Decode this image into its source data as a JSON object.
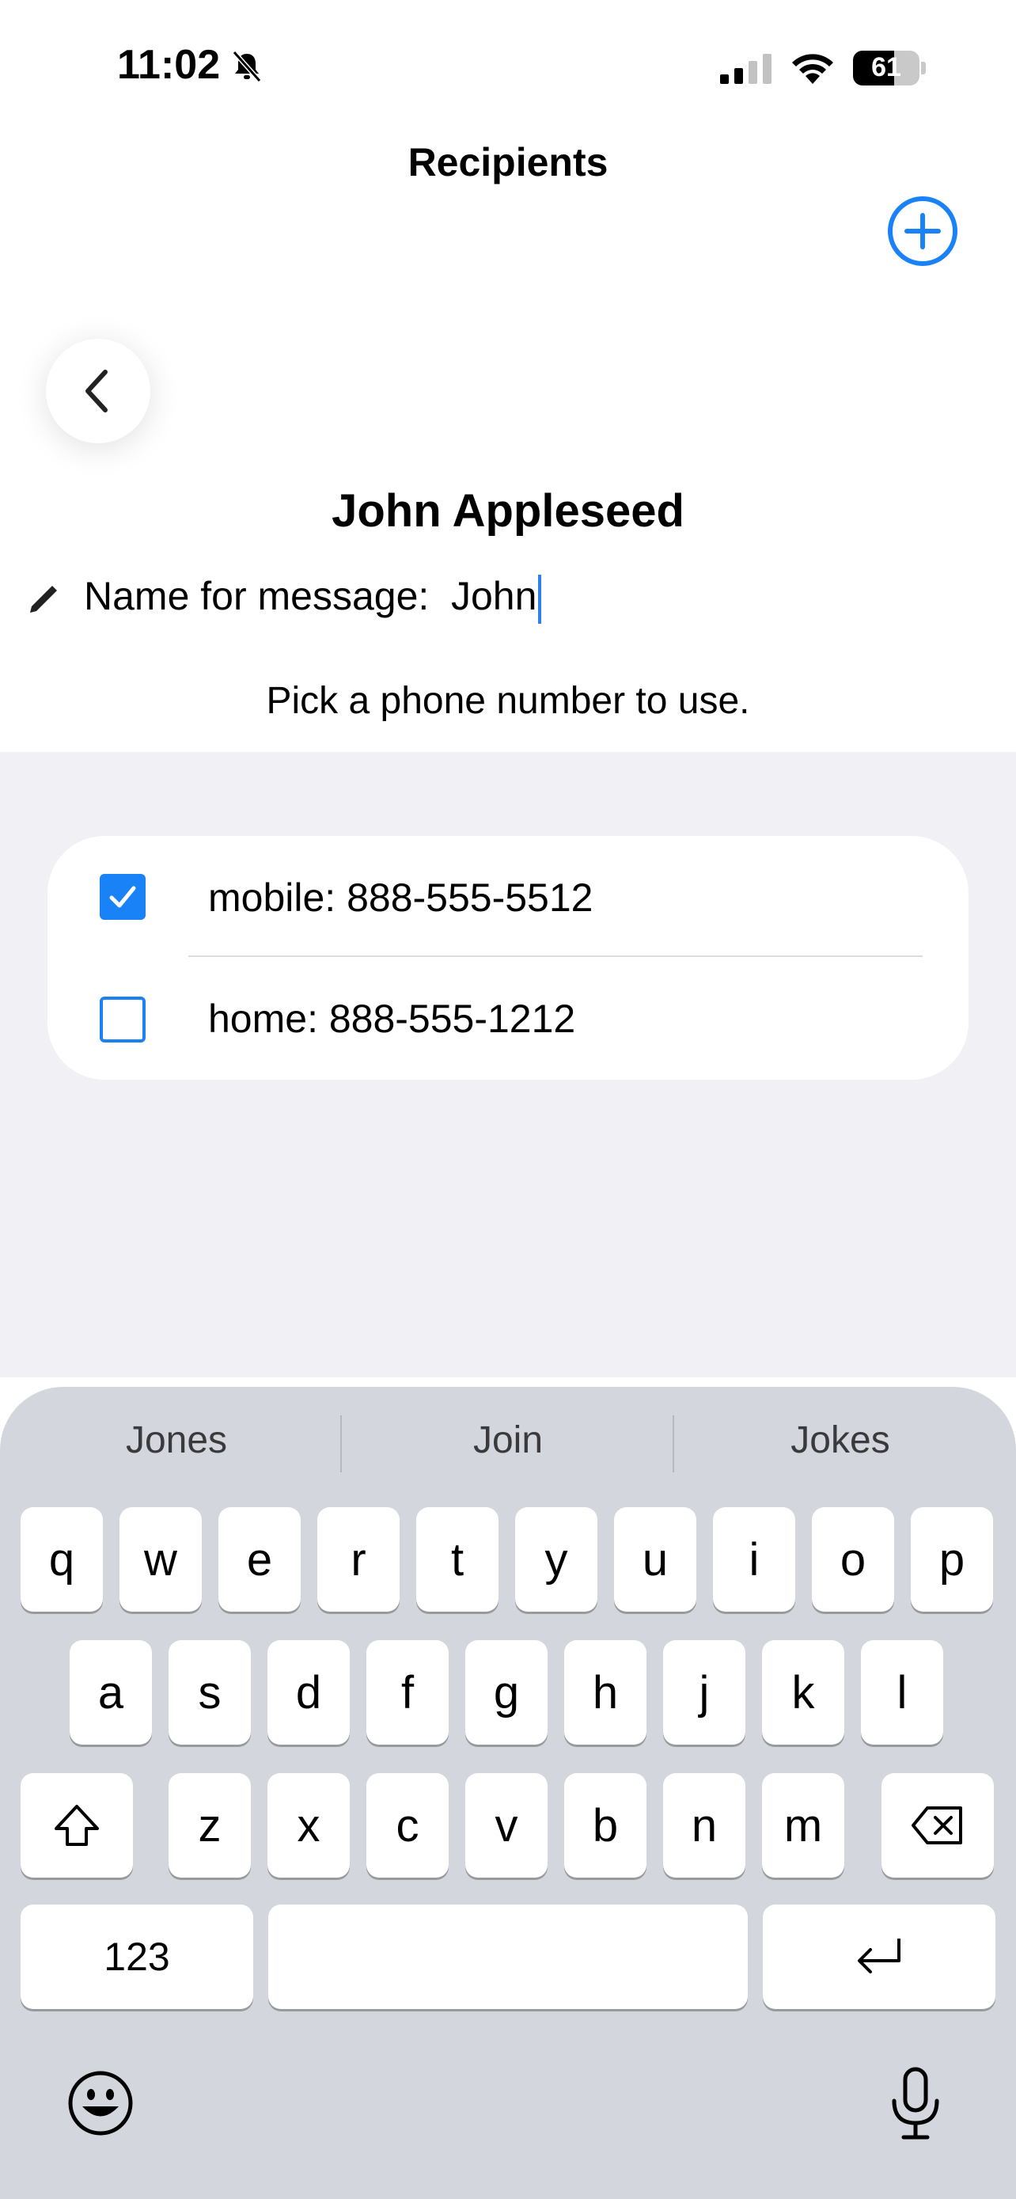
{
  "status_bar": {
    "time": "11:02",
    "battery": "61"
  },
  "header": {
    "title": "Recipients"
  },
  "contact": {
    "name": "John Appleseed",
    "name_label": "Name for message:",
    "name_value": "John",
    "hint": "Pick a phone number to use."
  },
  "phones": [
    {
      "label": "mobile: 888-555-5512",
      "checked": true
    },
    {
      "label": "home: 888-555-1212",
      "checked": false
    }
  ],
  "keyboard": {
    "suggestions": [
      "Jones",
      "Join",
      "Jokes"
    ],
    "row1": [
      "q",
      "w",
      "e",
      "r",
      "t",
      "y",
      "u",
      "i",
      "o",
      "p"
    ],
    "row2": [
      "a",
      "s",
      "d",
      "f",
      "g",
      "h",
      "j",
      "k",
      "l"
    ],
    "row3": [
      "z",
      "x",
      "c",
      "v",
      "b",
      "n",
      "m"
    ],
    "numbers_label": "123"
  },
  "colors": {
    "accent": "#1a82f7",
    "content_bg": "#f0f0f5",
    "keyboard_bg": "#d3d6dc"
  }
}
